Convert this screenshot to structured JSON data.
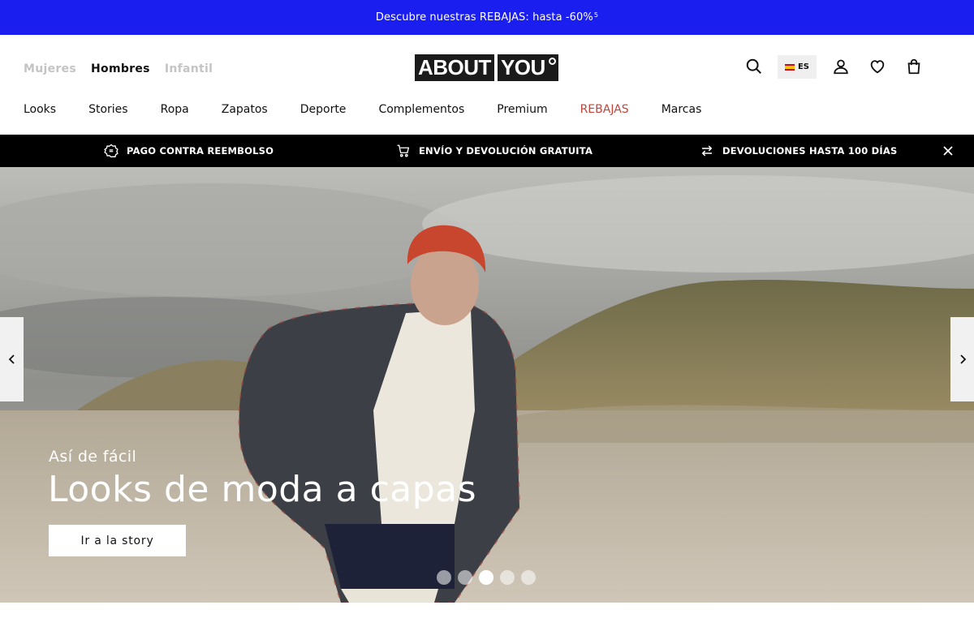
{
  "promo": {
    "text": "Descubre nuestras REBAJAS: hasta -60%",
    "footnote": "5"
  },
  "header": {
    "gender_tabs": [
      "Mujeres",
      "Hombres",
      "Infantil"
    ],
    "active_gender": "Hombres",
    "logo": {
      "part1": "ABOUT",
      "part2": "YOU"
    },
    "language": "ES",
    "nav": [
      "Looks",
      "Stories",
      "Ropa",
      "Zapatos",
      "Deporte",
      "Complementos",
      "Premium",
      "REBAJAS",
      "Marcas"
    ],
    "sale_color": "#c2453b"
  },
  "infobar": {
    "items": [
      "PAGO CONTRA REEMBOLSO",
      "ENVÍO Y DEVOLUCIÓN GRATUITA",
      "DEVOLUCIONES HASTA 100 DÍAS"
    ]
  },
  "hero": {
    "subtitle": "Así de fácil",
    "title": "Looks de moda a capas",
    "cta": "Ir a la story",
    "slides": 5,
    "active_slide": 3
  },
  "colors": {
    "promo_bg": "#1a1ff0",
    "info_bg": "#000000"
  }
}
